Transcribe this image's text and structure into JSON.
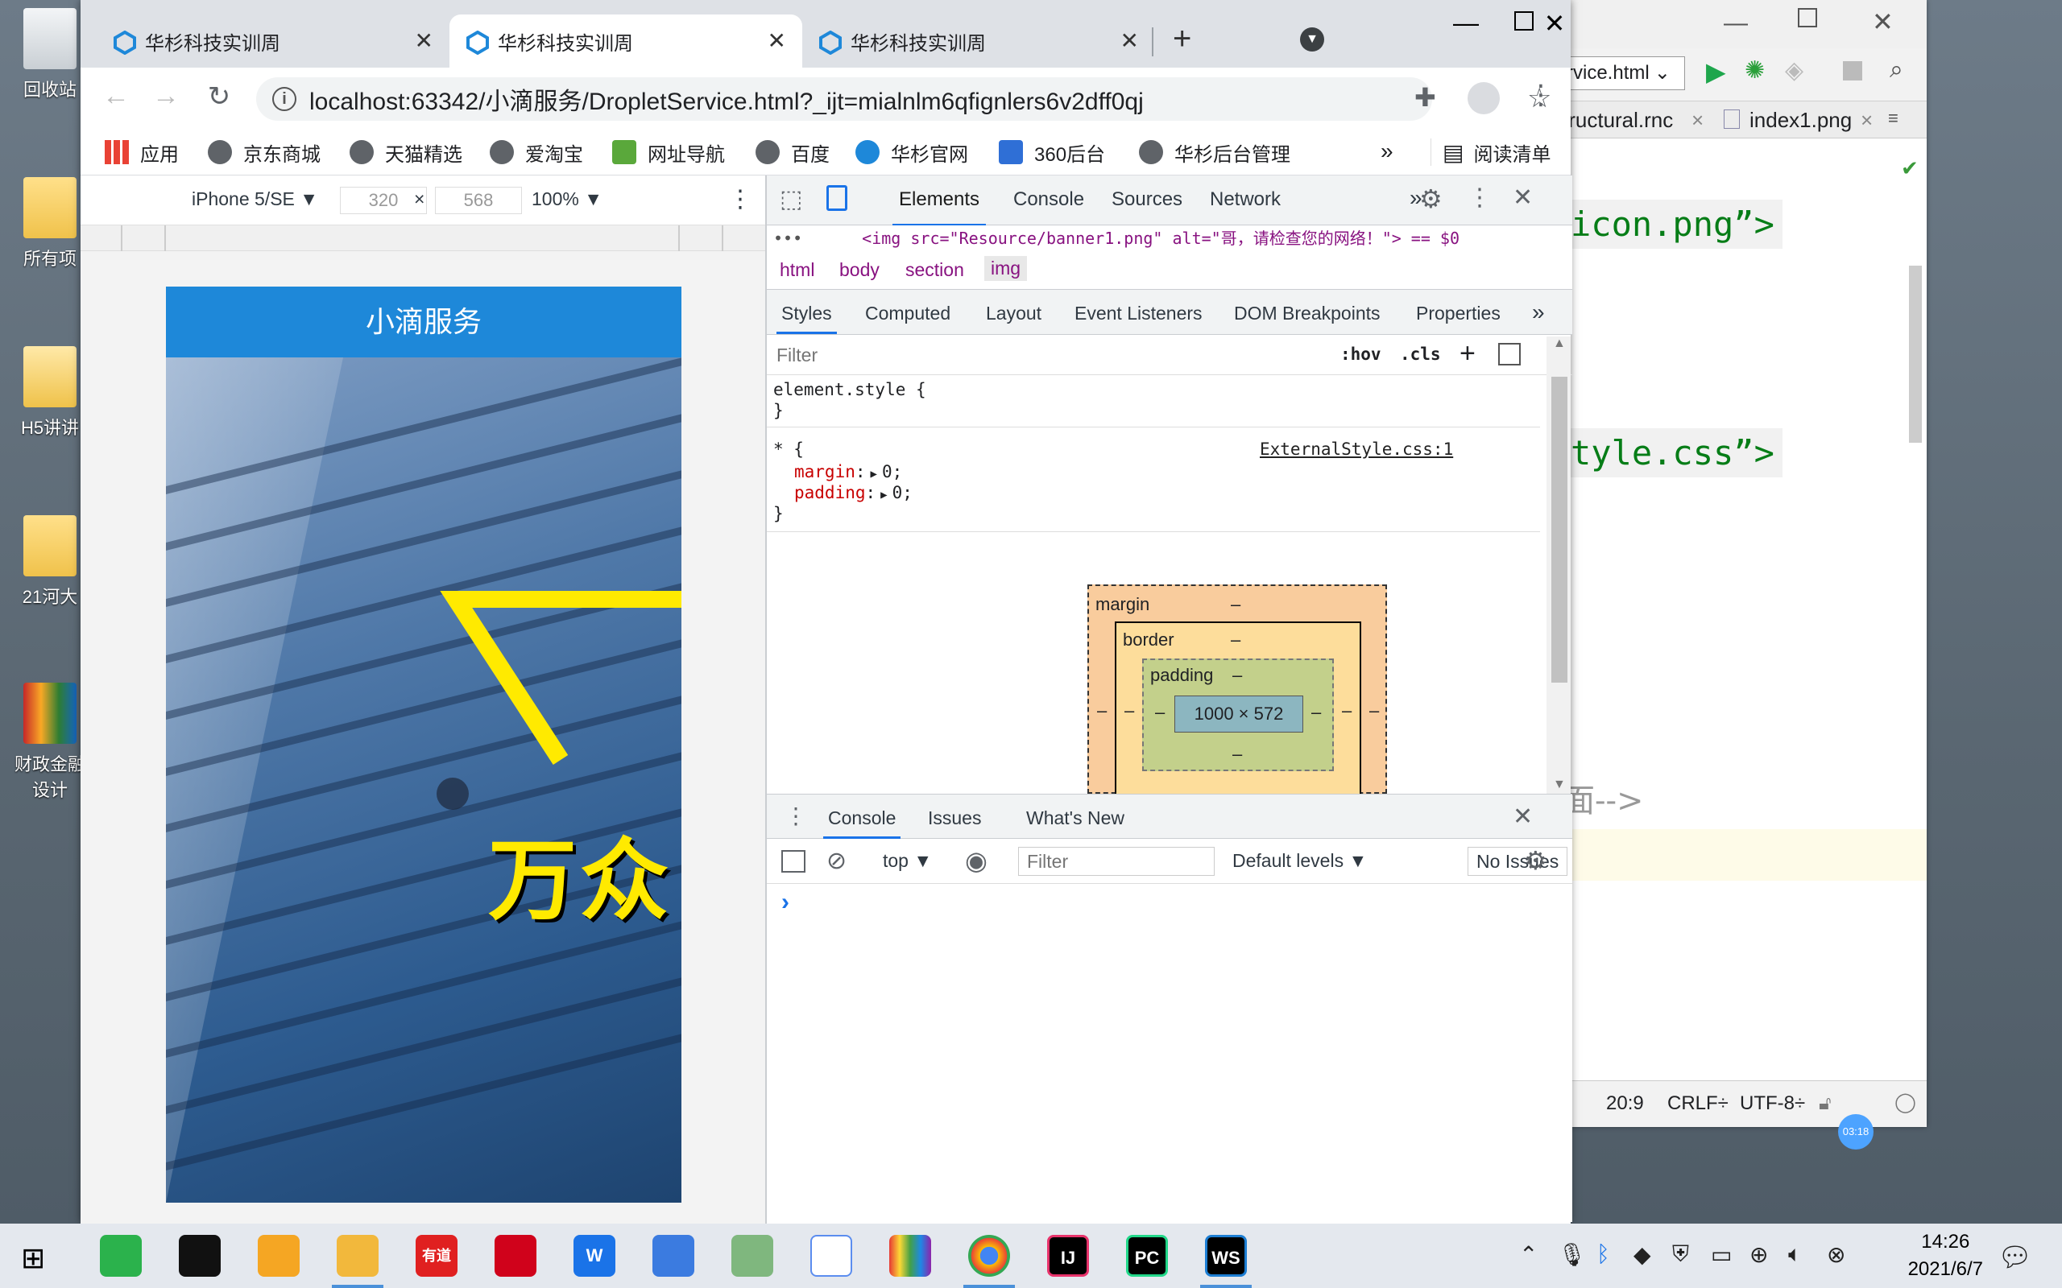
{
  "desktop": {
    "icons": [
      {
        "label": "回收站"
      },
      {
        "label": "所有项"
      },
      {
        "label": "H5讲讲"
      },
      {
        "label": "21河大"
      },
      {
        "label": "财政金融设计"
      }
    ]
  },
  "ide": {
    "run_config": "rvice.html",
    "tabs": [
      "tructural.rnc",
      "index1.png"
    ],
    "code_lines": [
      "icon.png”>",
      "tyle.css”>",
      "面-->"
    ],
    "status": {
      "position": "20:9",
      "line_sep": "CRLF÷",
      "encoding": "UTF-8÷",
      "time_badge": "03:18"
    }
  },
  "browser": {
    "tabs": [
      {
        "title": "华杉科技实训周",
        "active": false
      },
      {
        "title": "华杉科技实训周",
        "active": true
      },
      {
        "title": "华杉科技实训周",
        "active": false
      }
    ],
    "new_tab_label": "+",
    "url": "localhost:63342/小滴服务/DropletService.html?_ijt=mialnlm6qfignlers6v2dff0qj",
    "bookmarks": [
      {
        "label": "应用"
      },
      {
        "label": "京东商城"
      },
      {
        "label": "天猫精选"
      },
      {
        "label": "爱淘宝"
      },
      {
        "label": "网址导航"
      },
      {
        "label": "百度"
      },
      {
        "label": "华杉官网"
      },
      {
        "label": "360后台"
      },
      {
        "label": "华杉后台管理"
      }
    ],
    "bookmarks_overflow": "»",
    "reading_list": "阅读清单"
  },
  "device_toolbar": {
    "device": "iPhone 5/SE",
    "width": "320",
    "height": "568",
    "times": "×",
    "zoom": "100%"
  },
  "page": {
    "header_title": "小滴服务",
    "banner_text": "万众"
  },
  "devtools": {
    "tabs": [
      "Elements",
      "Console",
      "Sources",
      "Network"
    ],
    "more": "»",
    "dom_line": "<img src=\"Resource/banner1.png\" alt=\"哥，请检查您的网络！\"> == $0",
    "breadcrumbs": [
      "html",
      "body",
      "section",
      "img"
    ],
    "style_tabs": [
      "Styles",
      "Computed",
      "Layout",
      "Event Listeners",
      "DOM Breakpoints",
      "Properties"
    ],
    "filter_placeholder": "Filter",
    "hov": ":hov",
    "cls": ".cls",
    "element_style_open": "element.style {",
    "close_brace": "}",
    "rule_selector": "* {",
    "rule_source": "ExternalStyle.css:1",
    "rule_props": [
      {
        "name": "margin",
        "value": "0;"
      },
      {
        "name": "padding",
        "value": "0;"
      }
    ],
    "box_model": {
      "margin_label": "margin",
      "border_label": "border",
      "padding_label": "padding",
      "dash": "–",
      "content": "1000 × 572"
    },
    "drawer_tabs": [
      "Console",
      "Issues",
      "What's New"
    ],
    "console_context": "top",
    "console_filter_placeholder": "Filter",
    "default_levels": "Default levels",
    "no_issues": "No Issues",
    "prompt": "›"
  },
  "taskbar": {
    "time": "14:26",
    "date": "2021/6/7",
    "apps": [
      {
        "label": "",
        "color": "#2bb24c"
      },
      {
        "label": "",
        "color": "#111111"
      },
      {
        "label": "",
        "color": "#f5a623"
      },
      {
        "label": "",
        "color": "#f2b83c"
      },
      {
        "label": "有道",
        "color": "#e02020"
      },
      {
        "label": "",
        "color": "#d0021b"
      },
      {
        "label": "W",
        "color": "#1a73e8"
      },
      {
        "label": "",
        "color": "#3b7be0"
      },
      {
        "label": "",
        "color": "#7fb77e"
      },
      {
        "label": "",
        "color": "#ffffff"
      },
      {
        "label": "",
        "color": "#8e44ad"
      },
      {
        "label": "",
        "color": "#dd4b39"
      },
      {
        "label": "IJ",
        "color": "#e8336b"
      },
      {
        "label": "PC",
        "color": "#21d789"
      },
      {
        "label": "WS",
        "color": "#1d7ed3"
      }
    ]
  }
}
